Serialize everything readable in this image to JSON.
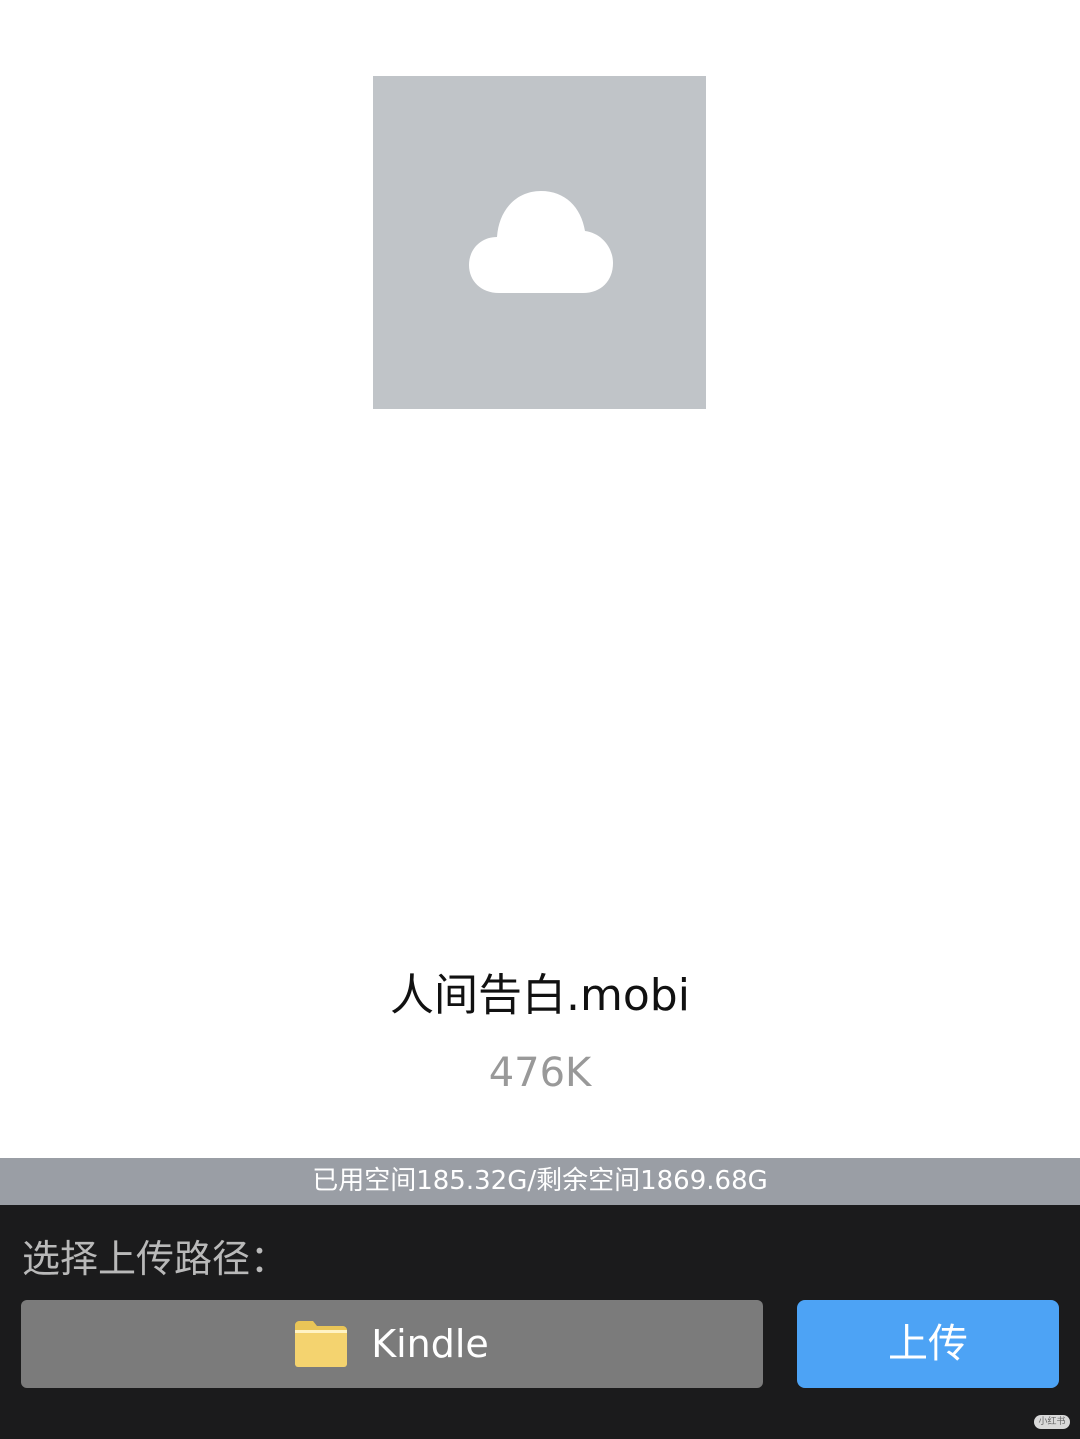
{
  "preview": {
    "thumbnail_bg": "#c0c4c8",
    "icon": "cloud-icon"
  },
  "file": {
    "name": "人间告白.mobi",
    "size": "476K"
  },
  "storage": {
    "text": "已用空间185.32G/剩余空间1869.68G"
  },
  "upload_panel": {
    "path_label": "选择上传路径：",
    "folder": {
      "icon": "folder-icon",
      "label": "Kindle"
    },
    "upload_button_label": "上传",
    "accent_color": "#4da3f5"
  },
  "watermark": {
    "text": "小红书"
  }
}
